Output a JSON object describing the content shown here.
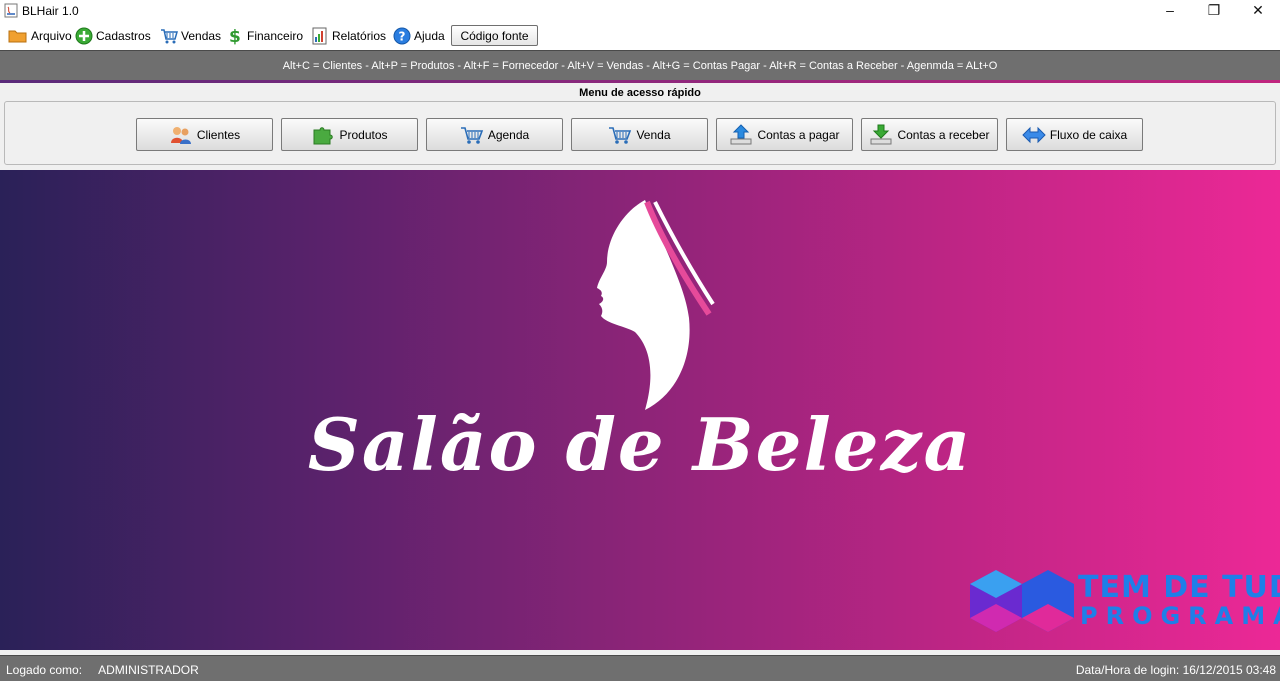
{
  "window": {
    "title": "BLHair 1.0",
    "icon": "java-app-icon",
    "controls": {
      "minimize": "–",
      "restore": "❐",
      "close": "✕"
    }
  },
  "menu": {
    "items": [
      {
        "label": "Arquivo",
        "icon": "folder-icon"
      },
      {
        "label": "Cadastros",
        "icon": "plus-circle-icon"
      },
      {
        "label": "Vendas",
        "icon": "cart-icon"
      },
      {
        "label": "Financeiro",
        "icon": "dollar-icon"
      },
      {
        "label": "Relatórios",
        "icon": "report-icon"
      },
      {
        "label": "Ajuda",
        "icon": "help-icon"
      }
    ],
    "source_button": "Código fonte"
  },
  "shortcuts": {
    "text": "Alt+C = Clientes   -   Alt+P = Produtos   -   Alt+F = Fornecedor   -   Alt+V = Vendas   -   Alt+G = Contas Pagar   -   Alt+R = Contas a Receber   -   Agenmda =  ALt+O"
  },
  "quick_access": {
    "title": "Menu de acesso rápido",
    "buttons": [
      {
        "label": "Clientes",
        "icon": "users-icon"
      },
      {
        "label": "Produtos",
        "icon": "puzzle-icon"
      },
      {
        "label": "Agenda",
        "icon": "cart-icon"
      },
      {
        "label": "Venda",
        "icon": "cart-icon"
      },
      {
        "label": "Contas a pagar",
        "icon": "upload-icon"
      },
      {
        "label": "Contas a receber",
        "icon": "download-icon"
      },
      {
        "label": "Fluxo de caixa",
        "icon": "double-arrow-icon"
      }
    ]
  },
  "banner": {
    "brand": "Salão de Beleza",
    "watermark_line1": "TEM DE TUDO",
    "watermark_line2": "PROGRAMAS",
    "colors": {
      "gradient_start": "#2a2158",
      "gradient_end": "#ec2896",
      "watermark": "#1e7fe8"
    }
  },
  "status": {
    "logged_label": "Logado como:",
    "logged_user": "ADMINISTRADOR",
    "login_label": "Data/Hora de login:",
    "login_time": "16/12/2015 03:48"
  }
}
